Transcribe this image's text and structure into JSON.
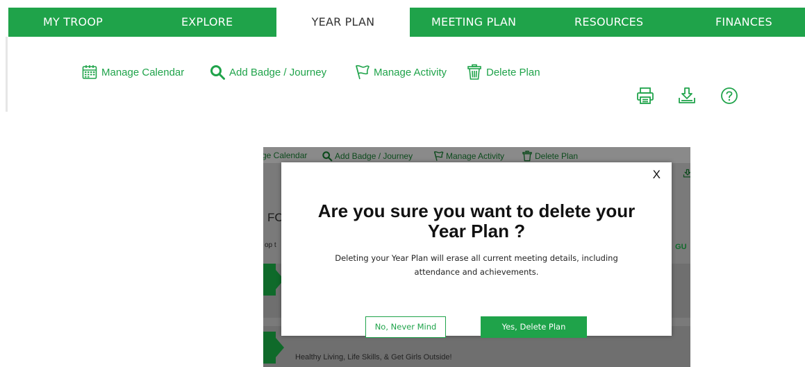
{
  "nav": {
    "tabs": [
      {
        "label": "MY TROOP"
      },
      {
        "label": "EXPLORE"
      },
      {
        "label": "YEAR PLAN"
      },
      {
        "label": "MEETING PLAN"
      },
      {
        "label": "RESOURCES"
      },
      {
        "label": "FINANCES"
      }
    ],
    "active_tab": "YEAR PLAN"
  },
  "toolbar": {
    "items": [
      {
        "label": "Manage Calendar",
        "icon": "calendar-icon"
      },
      {
        "label": "Add Badge / Journey",
        "icon": "search-icon"
      },
      {
        "label": "Manage Activity",
        "icon": "flag-icon"
      },
      {
        "label": "Delete Plan",
        "icon": "trash-icon"
      }
    ],
    "utilities": [
      {
        "icon": "print-icon"
      },
      {
        "icon": "download-icon"
      },
      {
        "icon": "help-icon"
      }
    ]
  },
  "inset": {
    "background_toolbar": {
      "calendar_partial": "ge Calendar",
      "badge": "Add Badge / Journey",
      "activity": "Manage Activity",
      "delete": "Delete Plan"
    },
    "background_text": {
      "heading_partial": "FC",
      "subtext_partial": "op t",
      "right_partial": " GU",
      "bottom_row": "Healthy Living, Life Skills, & Get Girls Outside!"
    },
    "modal": {
      "close_label": "X",
      "title": "Are you sure you want to delete your Year Plan ?",
      "body": "Deleting your Year Plan will erase all current meeting details, including attendance and achievements.",
      "cancel_label": "No, Never Mind",
      "confirm_label": "Yes, Delete Plan"
    }
  },
  "colors": {
    "brand_green": "#1fa34a",
    "overlay_gray": "#7a7a7a"
  }
}
